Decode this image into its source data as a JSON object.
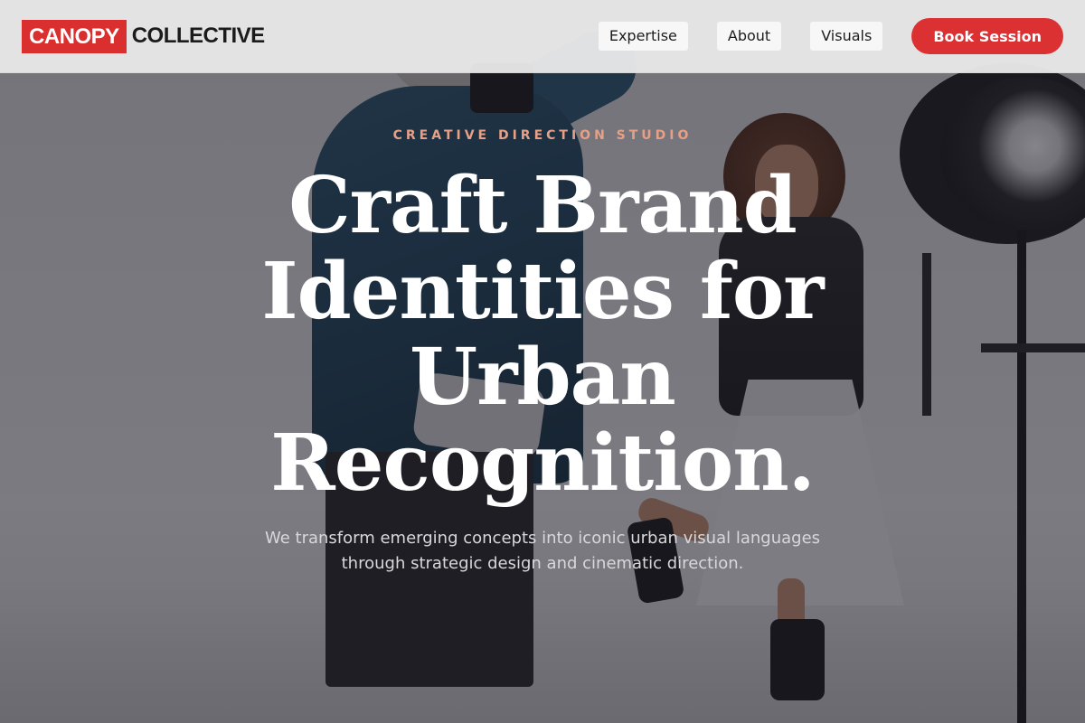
{
  "header": {
    "logo": {
      "primary": "CANOPY",
      "secondary": "COLLECTIVE"
    },
    "nav": [
      {
        "label": "Expertise"
      },
      {
        "label": "About"
      },
      {
        "label": "Visuals"
      }
    ],
    "cta_label": "Book Session"
  },
  "hero": {
    "eyebrow": "CREATIVE DIRECTION STUDIO",
    "headline": "Craft Brand Identities for Urban Recognition.",
    "subhead": "We transform emerging concepts into iconic urban visual languages through strategic design and cinematic direction.",
    "background_description": "Photographer shooting a smiling model in a leather jacket and white skirt in a bright studio with a large light reflector."
  },
  "colors": {
    "brand_red": "#d9302f",
    "cta_red": "#db3133",
    "eyebrow_salmon": "#e6a087",
    "header_bg": "#e8e8e8",
    "headline_white": "#ffffff"
  },
  "icons": {}
}
